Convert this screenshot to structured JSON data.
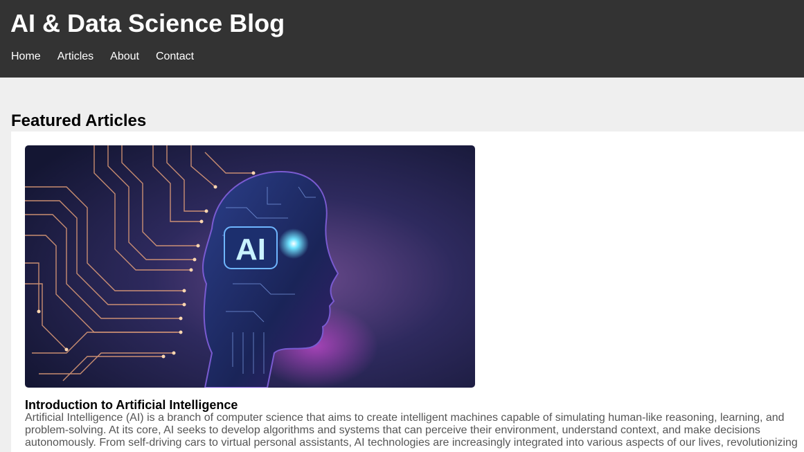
{
  "header": {
    "site_title": "AI & Data Science Blog",
    "nav": [
      {
        "label": "Home"
      },
      {
        "label": "Articles"
      },
      {
        "label": "About"
      },
      {
        "label": "Contact"
      }
    ]
  },
  "main": {
    "section_title": "Featured Articles",
    "articles": [
      {
        "image_icon": "ai-head-circuit-illustration",
        "image_badge": "AI",
        "title": "Introduction to Artificial Intelligence",
        "excerpt": "Artificial Intelligence (AI) is a branch of computer science that aims to create intelligent machines capable of simulating human-like reasoning, learning, and problem-solving. At its core, AI seeks to develop algorithms and systems that can perceive their environment, understand context, and make decisions autonomously. From self-driving cars to virtual personal assistants, AI technologies are increasingly integrated into various aspects of our lives, revolutionizing"
      }
    ]
  },
  "colors": {
    "header_bg": "#333333",
    "page_bg": "#efefef",
    "card_bg": "#ffffff",
    "excerpt_text": "#555555"
  }
}
